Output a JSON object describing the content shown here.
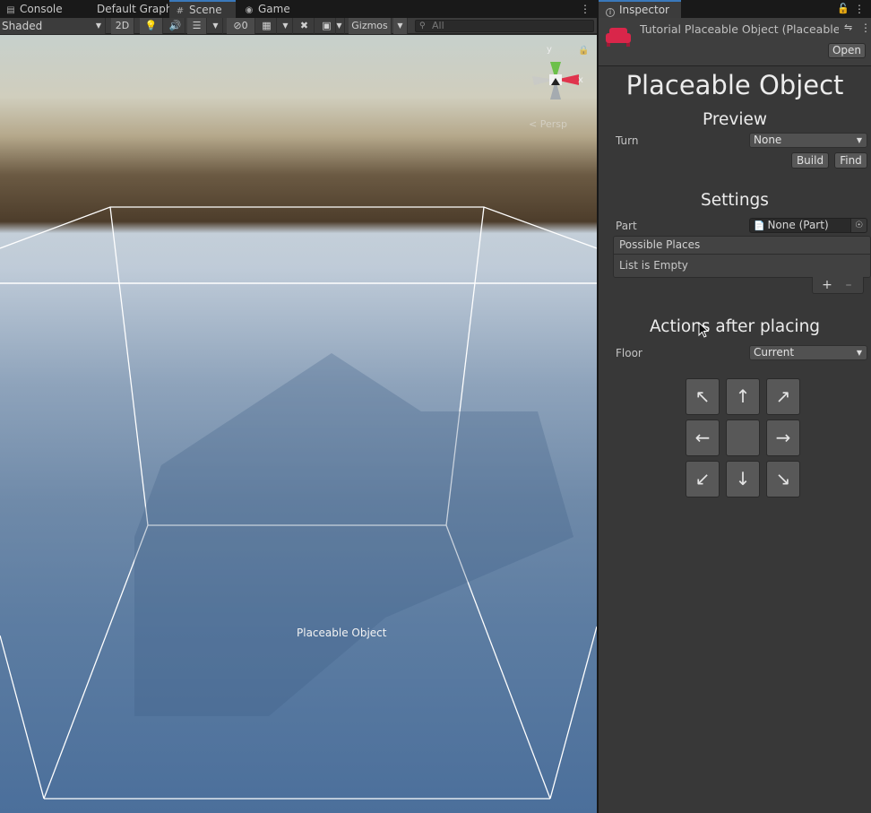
{
  "tabs": {
    "console": "Console",
    "graph": "Default Graph",
    "scene": "Scene",
    "game": "Game"
  },
  "toolbar": {
    "shading_mode": "Shaded",
    "btn_2d": "2D",
    "hidden_count": "0",
    "gizmos": "Gizmos",
    "search_placeholder": "All"
  },
  "scene": {
    "object_label": "Placeable Object",
    "gizmo_y": "y",
    "gizmo_x": "x",
    "projection": "< Persp"
  },
  "inspector": {
    "tab_label": "Inspector",
    "asset_title": "Tutorial Placeable Object (Placeable",
    "open_label": "Open",
    "main_title": "Placeable Object",
    "preview": {
      "heading": "Preview",
      "turn_label": "Turn",
      "turn_value": "None",
      "build_label": "Build",
      "find_label": "Find"
    },
    "settings": {
      "heading": "Settings",
      "part_label": "Part",
      "part_value": "None (Part)",
      "list_header": "Possible Places",
      "list_empty": "List is Empty",
      "add_label": "+",
      "remove_label": "–"
    },
    "actions": {
      "heading": "Actions after placing",
      "floor_label": "Floor",
      "floor_value": "Current",
      "pad": {
        "up_left": "↖",
        "up": "↑",
        "up_right": "↗",
        "left": "←",
        "center": "",
        "right": "→",
        "down_left": "↙",
        "down": "↓",
        "down_right": "↘"
      }
    }
  },
  "colors": {
    "accent_tab": "#3a79bb",
    "asset_icon": "#d9264a",
    "gizmo_x": "#e0344d",
    "gizmo_y": "#6cc04a"
  },
  "icons": {
    "console": "console-icon",
    "scene": "scene-grid-icon",
    "game": "gamepad-icon",
    "inspector": "info-icon",
    "lock": "lock-icon",
    "menu": "kebab-menu-icon"
  }
}
